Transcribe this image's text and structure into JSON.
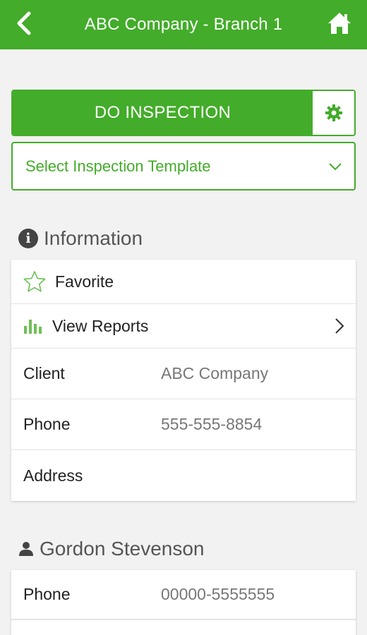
{
  "header": {
    "title": "ABC Company - Branch 1",
    "back_icon": "chevron-left-icon",
    "home_icon": "home-icon"
  },
  "inspection": {
    "button_label": "DO INSPECTION",
    "settings_icon": "gear-icon",
    "template_placeholder": "Select Inspection Template"
  },
  "information": {
    "heading": "Information",
    "favorite_label": "Favorite",
    "reports_label": "View Reports",
    "rows": [
      {
        "label": "Client",
        "value": "ABC Company"
      },
      {
        "label": "Phone",
        "value": "555-555-8854"
      },
      {
        "label": "Address",
        "value": ""
      }
    ]
  },
  "contact": {
    "heading": "Gordon Stevenson",
    "rows": [
      {
        "label": "Phone",
        "value": "00000-5555555"
      }
    ]
  },
  "colors": {
    "brand": "#43ac2a",
    "background": "#f2f2f2"
  }
}
